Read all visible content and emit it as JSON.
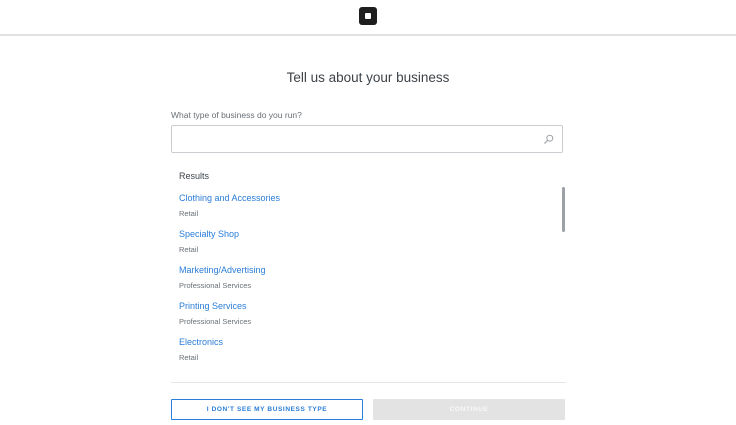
{
  "page": {
    "title": "Tell us about your business"
  },
  "search": {
    "label": "What type of business do you run?",
    "value": "",
    "placeholder": ""
  },
  "results": {
    "heading": "Results",
    "items": [
      {
        "name": "Clothing and Accessories",
        "category": "Retail"
      },
      {
        "name": "Specialty Shop",
        "category": "Retail"
      },
      {
        "name": "Marketing/Advertising",
        "category": "Professional Services"
      },
      {
        "name": "Printing Services",
        "category": "Professional Services"
      },
      {
        "name": "Electronics",
        "category": "Retail"
      }
    ]
  },
  "actions": {
    "not_listed_label": "I DON'T SEE MY BUSINESS TYPE",
    "continue_label": "CONTINUE"
  },
  "icons": {
    "logo": "square-logo-icon",
    "search": "search-icon"
  },
  "colors": {
    "link": "#2a7dd8",
    "disabled_button": "#e3e3e3",
    "text": "#3e4348"
  }
}
